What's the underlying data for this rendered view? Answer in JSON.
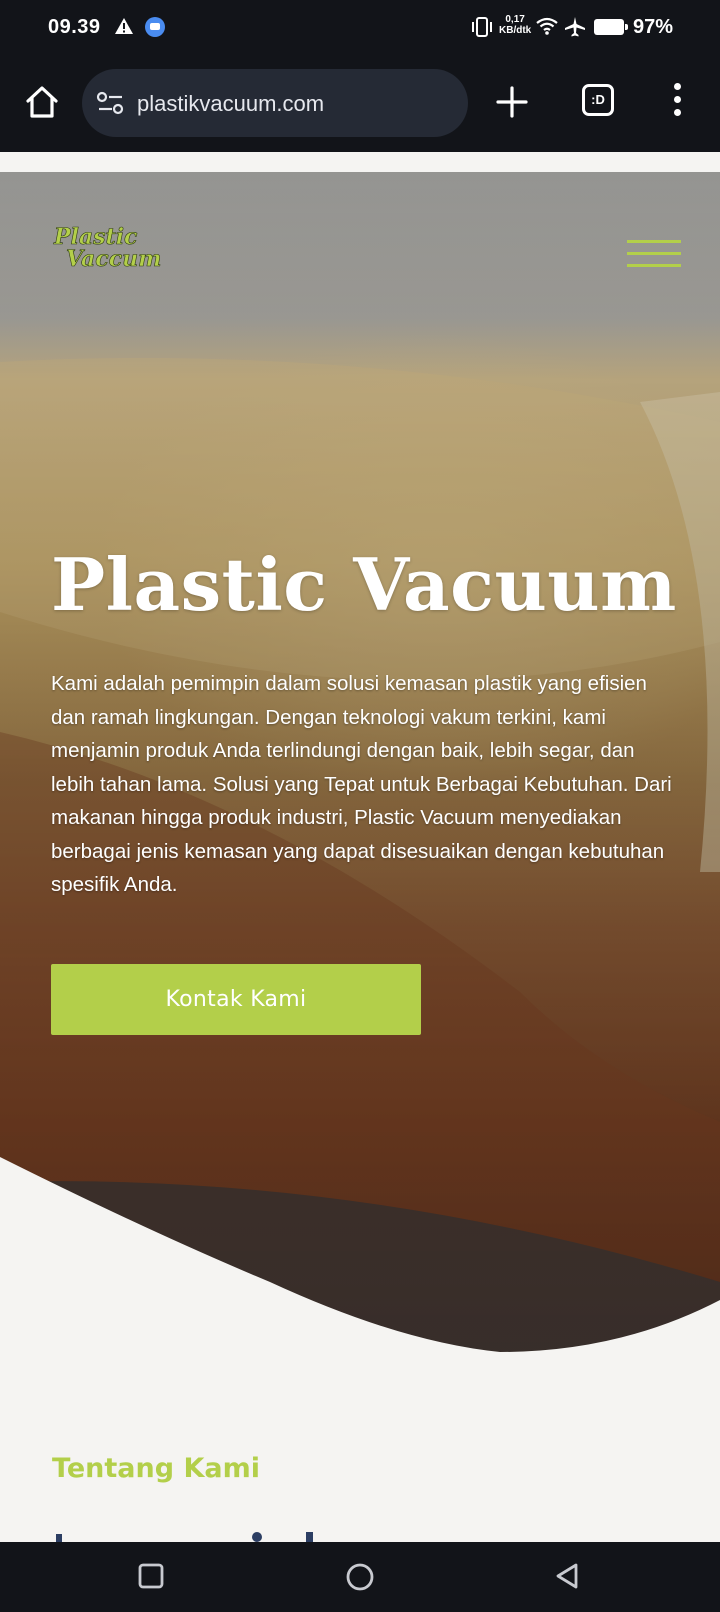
{
  "status_bar": {
    "time": "09.39",
    "net_speed_value": "0,17",
    "net_speed_unit": "KB/dtk",
    "battery": "97%",
    "icons": [
      "warning-icon",
      "app-notification-icon",
      "vibrate-icon",
      "wifi-icon",
      "airplane-icon",
      "battery-icon"
    ]
  },
  "browser": {
    "url": "plastikvacuum.com",
    "tab_count": ":D",
    "icons": [
      "home-icon",
      "site-settings-icon",
      "new-tab-icon",
      "tab-switcher-icon",
      "more-menu-icon"
    ]
  },
  "site": {
    "logo_line1": "Plastic",
    "logo_line2": "Vaccum",
    "hero_title": "Plastic Vacuum",
    "hero_text": "Kami adalah pemimpin dalam solusi kemasan plastik yang efisien dan ramah lingkungan. Dengan teknologi vakum terkini, kami menjamin produk Anda terlindungi dengan baik, lebih segar, dan lebih tahan lama. Solusi yang Tepat untuk Berbagai Kebutuhan. Dari makanan hingga produk industri, Plastic Vacuum menyediakan berbagai jenis kemasan yang dapat disesuaikan dengan kebutuhan spesifik Anda.",
    "cta_label": "Kontak Kami",
    "section_label": "Tentang Kami"
  },
  "colors": {
    "accent": "#b3cf4a",
    "heading_dark": "#2c3e63",
    "system_bar": "#121419",
    "page_bg": "#f5f4f2"
  }
}
